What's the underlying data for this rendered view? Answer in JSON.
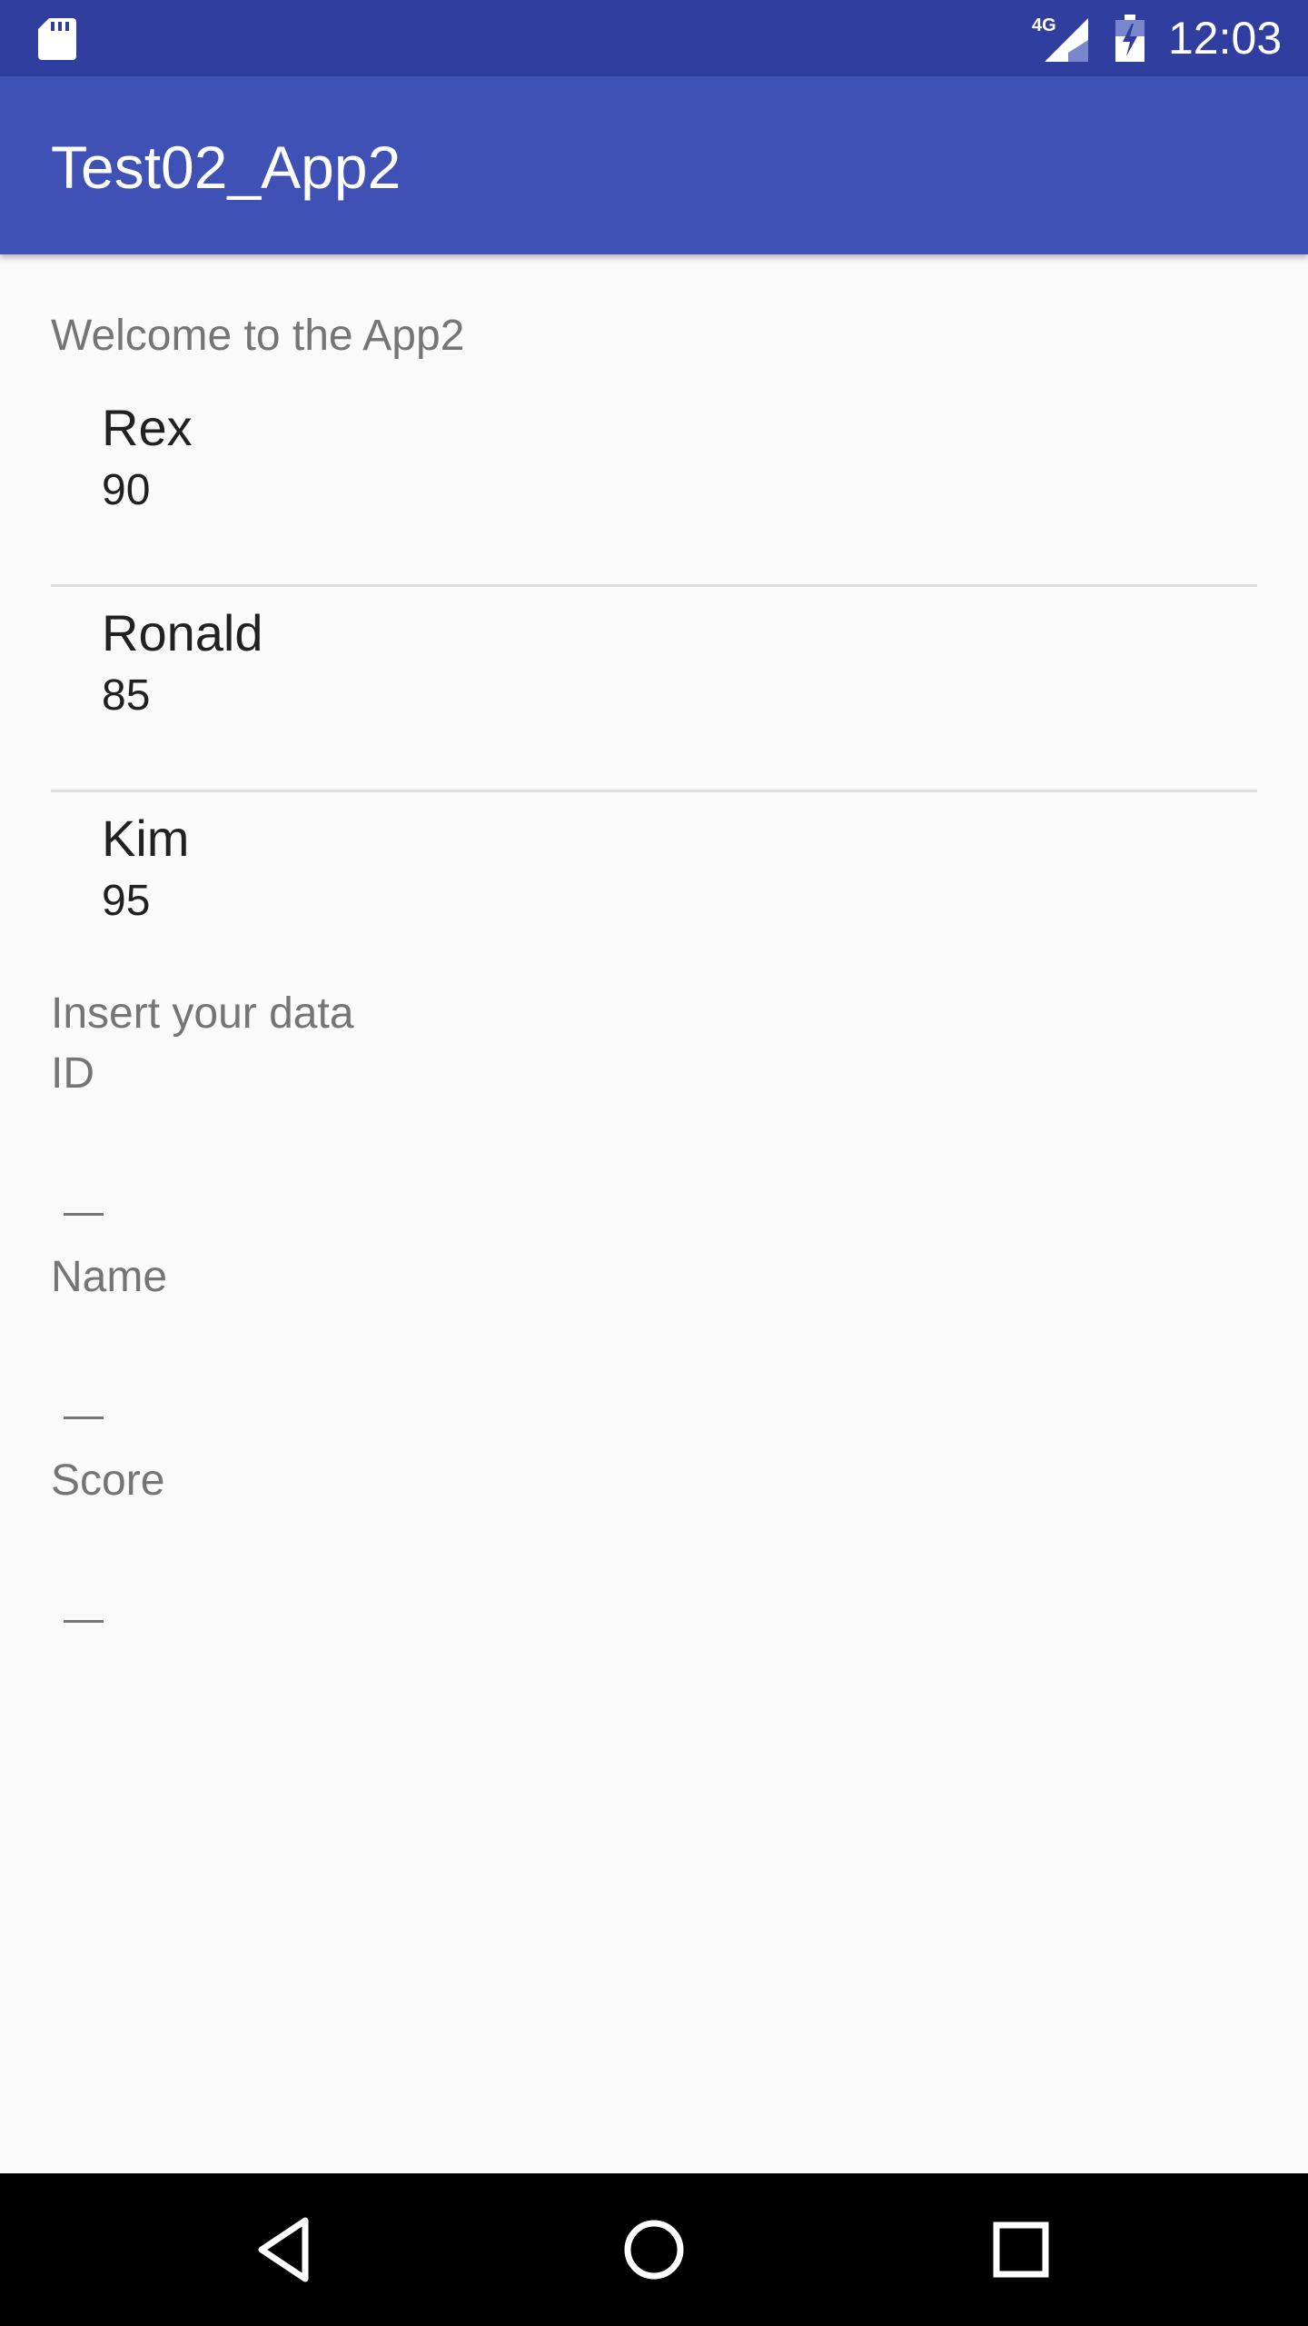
{
  "status_bar": {
    "time": "12:03",
    "network": "4G",
    "icons": [
      "sd-card-icon",
      "signal-icon",
      "battery-icon"
    ]
  },
  "app_bar": {
    "title": "Test02_App2",
    "color": "#3f51b5"
  },
  "welcome_text": "Welcome to the App2",
  "list": {
    "items": [
      {
        "name": "Rex",
        "score": "90"
      },
      {
        "name": "Ronald",
        "score": "85"
      },
      {
        "name": "Kim",
        "score": "95"
      }
    ]
  },
  "form": {
    "title": "Insert your data",
    "fields": [
      {
        "label": "ID",
        "value": ""
      },
      {
        "label": "Name",
        "value": ""
      },
      {
        "label": "Score",
        "value": ""
      }
    ]
  },
  "nav_bar": {
    "icons": [
      "back-icon",
      "home-icon",
      "recents-icon"
    ]
  },
  "colors": {
    "status_bar": "#303f9f",
    "app_bar": "#3f51b5",
    "background": "#fafafa",
    "secondary_text": "#757575"
  }
}
